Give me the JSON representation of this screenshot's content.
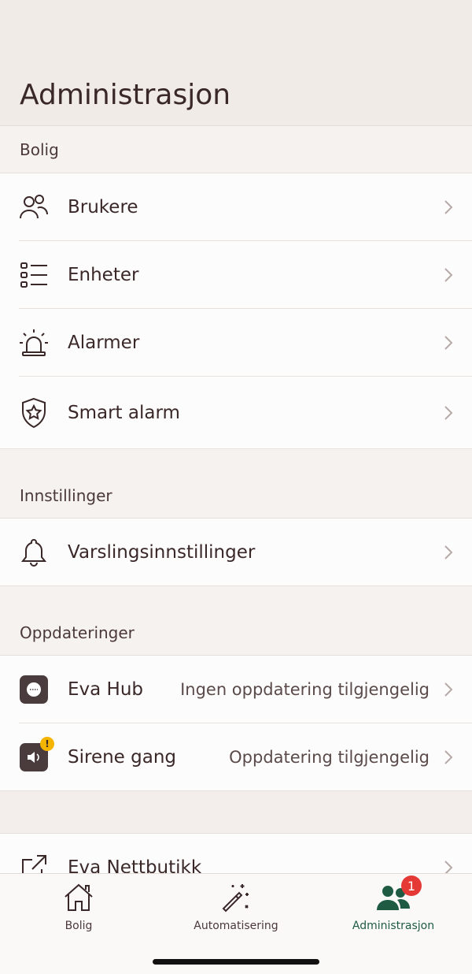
{
  "header": {
    "title": "Administrasjon"
  },
  "sections": {
    "bolig": {
      "title": "Bolig",
      "items": [
        {
          "label": "Brukere",
          "icon": "users-icon"
        },
        {
          "label": "Enheter",
          "icon": "list-icon"
        },
        {
          "label": "Alarmer",
          "icon": "siren-icon"
        },
        {
          "label": "Smart alarm",
          "icon": "shield-star-icon"
        }
      ]
    },
    "innstillinger": {
      "title": "Innstillinger",
      "items": [
        {
          "label": "Varslingsinnstillinger",
          "icon": "bell-icon"
        }
      ]
    },
    "oppdateringer": {
      "title": "Oppdateringer",
      "items": [
        {
          "label": "Eva Hub",
          "value": "Ingen oppdatering tilgjengelig",
          "icon": "hub-device-icon"
        },
        {
          "label": "Sirene gang",
          "value": "Oppdatering tilgjengelig",
          "icon": "siren-device-icon",
          "badge": "!"
        }
      ]
    },
    "extra": {
      "items": [
        {
          "label": "Eva Nettbutikk",
          "icon": "external-link-icon"
        }
      ]
    }
  },
  "tabbar": {
    "tabs": [
      {
        "label": "Bolig",
        "icon": "home-icon"
      },
      {
        "label": "Automatisering",
        "icon": "magic-wand-icon"
      },
      {
        "label": "Administrasjon",
        "icon": "users-filled-icon",
        "badge": "1",
        "active": true
      }
    ]
  },
  "colors": {
    "accent": "#1f5b43",
    "badge": "#e53935",
    "warning": "#f4b400",
    "text": "#3a2829"
  }
}
